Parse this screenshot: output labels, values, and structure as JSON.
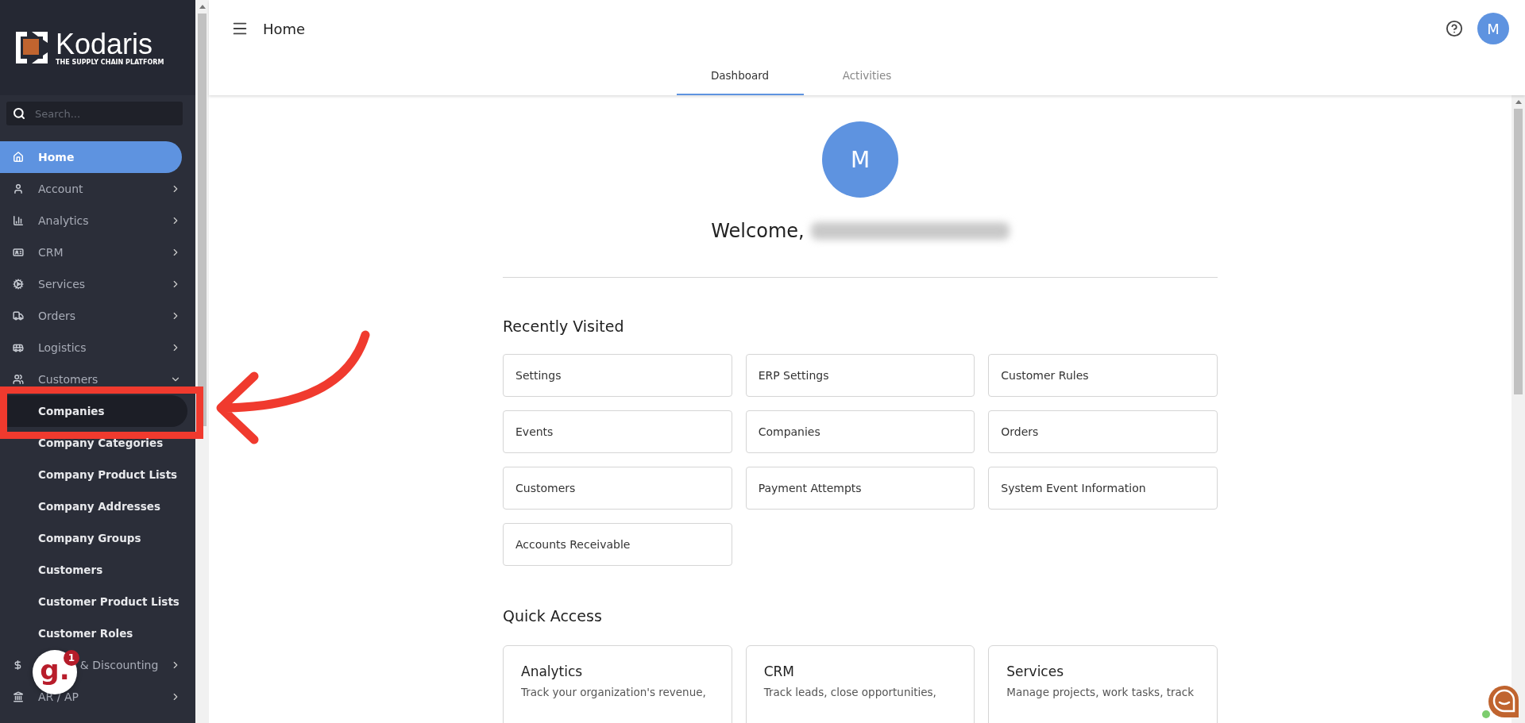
{
  "sidebar": {
    "logo": {
      "name": "Kodaris",
      "tagline": "THE SUPPLY CHAIN PLATFORM"
    },
    "search": {
      "placeholder": "Search..."
    },
    "items": [
      {
        "label": "Home",
        "kind": "link",
        "selected": true,
        "expanded": false,
        "obscured": false
      },
      {
        "label": "Account",
        "kind": "group",
        "selected": false,
        "expanded": false,
        "obscured": false
      },
      {
        "label": "Analytics",
        "kind": "group",
        "selected": false,
        "expanded": false,
        "obscured": false
      },
      {
        "label": "CRM",
        "kind": "group",
        "selected": false,
        "expanded": false,
        "obscured": false
      },
      {
        "label": "Services",
        "kind": "group",
        "selected": false,
        "expanded": false,
        "obscured": false
      },
      {
        "label": "Orders",
        "kind": "group",
        "selected": false,
        "expanded": false,
        "obscured": false
      },
      {
        "label": "Logistics",
        "kind": "group",
        "selected": false,
        "expanded": false,
        "obscured": false
      },
      {
        "label": "Customers",
        "kind": "group",
        "selected": false,
        "expanded": true,
        "obscured": false,
        "children": [
          {
            "label": "Companies",
            "selected": true,
            "highlighted": true
          },
          {
            "label": "Company Categories",
            "selected": false,
            "highlighted": false
          },
          {
            "label": "Company Product Lists",
            "selected": false,
            "highlighted": false
          },
          {
            "label": "Company Addresses",
            "selected": false,
            "highlighted": false
          },
          {
            "label": "Company Groups",
            "selected": false,
            "highlighted": false
          },
          {
            "label": "Customers",
            "selected": false,
            "highlighted": false
          },
          {
            "label": "Customer Product Lists",
            "selected": false,
            "highlighted": false
          },
          {
            "label": "Customer Roles",
            "selected": false,
            "highlighted": false
          }
        ]
      },
      {
        "label": "& Discounting",
        "kind": "group",
        "selected": false,
        "expanded": false,
        "obscured": true
      },
      {
        "label": "AR / AP",
        "kind": "group",
        "selected": false,
        "expanded": false,
        "obscured": false
      }
    ]
  },
  "header": {
    "title": "Home",
    "avatar": "M"
  },
  "tabs": [
    {
      "label": "Dashboard",
      "selected": true
    },
    {
      "label": "Activities",
      "selected": false
    }
  ],
  "welcome": {
    "avatar": "M",
    "greeting": "Welcome,"
  },
  "recently_visited": {
    "title": "Recently Visited",
    "items": [
      "Settings",
      "ERP Settings",
      "Customer Rules",
      "Events",
      "Companies",
      "Orders",
      "Customers",
      "Payment Attempts",
      "System Event Information",
      "Accounts Receivable"
    ]
  },
  "quick_access": {
    "title": "Quick Access",
    "cards": [
      {
        "title": "Analytics",
        "description": "Track your organization's revenue,"
      },
      {
        "title": "CRM",
        "description": "Track leads, close opportunities,"
      },
      {
        "title": "Services",
        "description": "Manage projects, work tasks, track"
      }
    ]
  },
  "launcher": {
    "glyph": "g.",
    "badge": "1"
  }
}
